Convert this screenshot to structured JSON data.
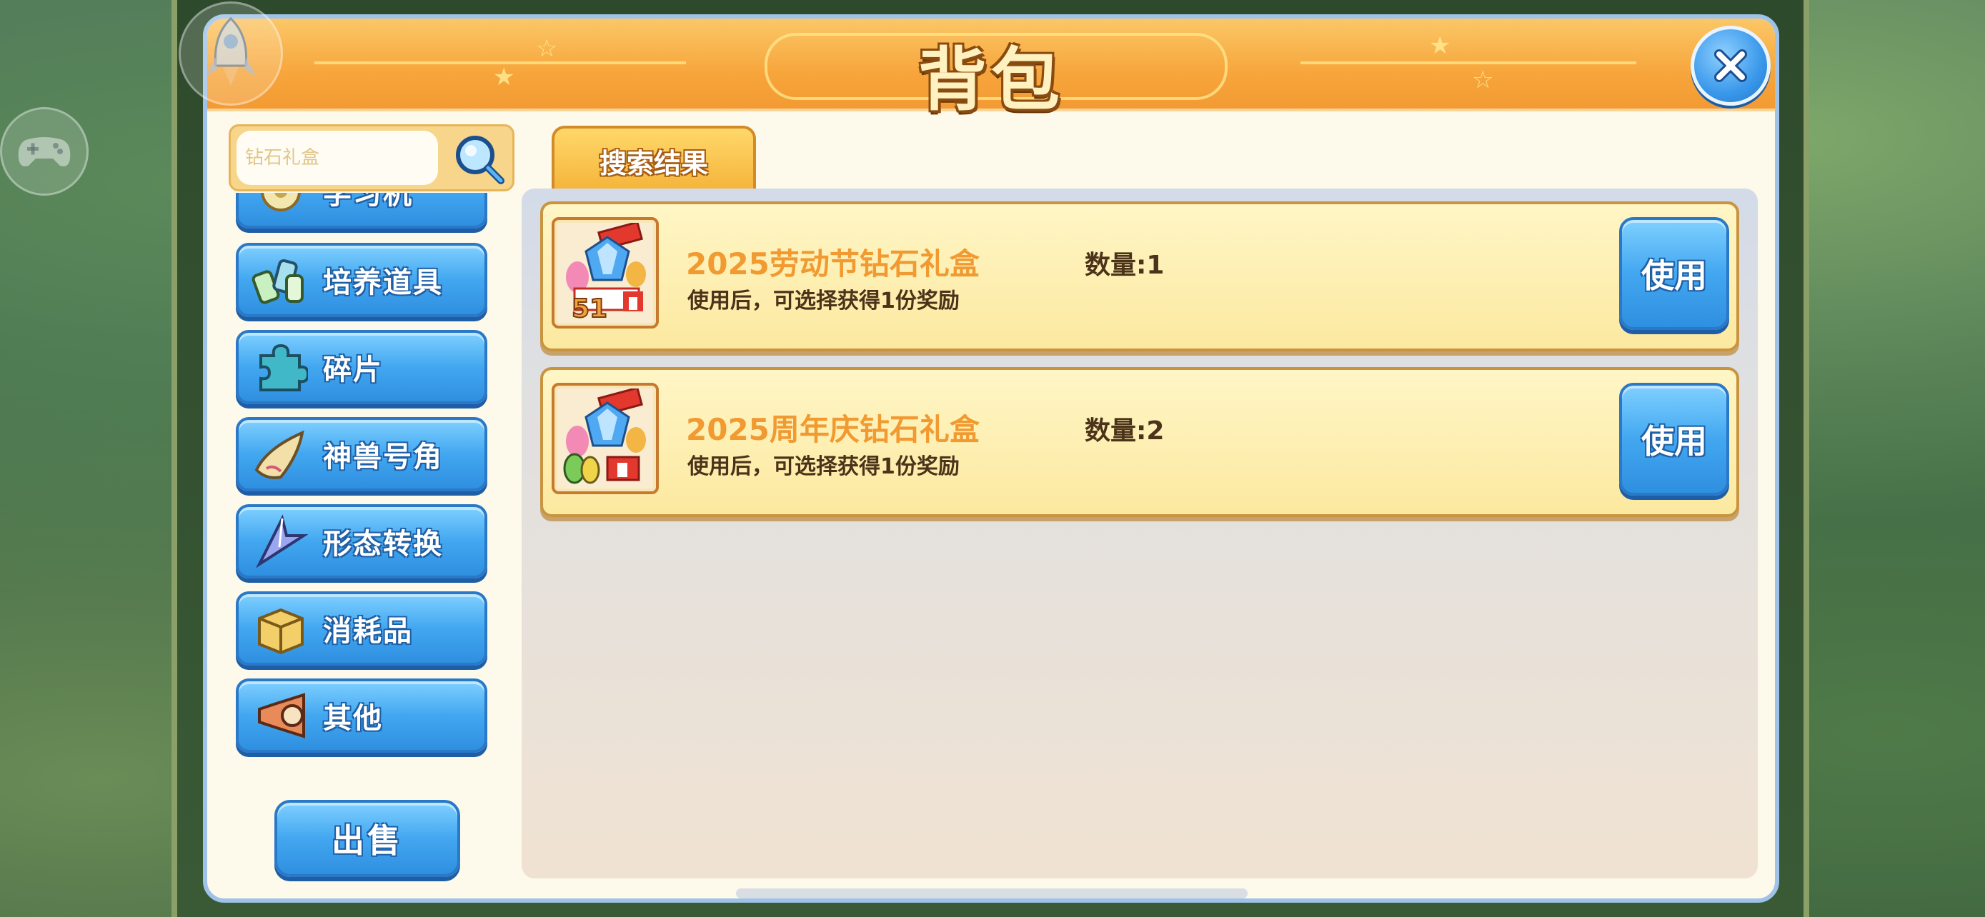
{
  "window": {
    "title": "背包"
  },
  "search": {
    "placeholder": "钻石礼盒",
    "value": ""
  },
  "sidebar": {
    "items": [
      {
        "label": "学习机",
        "icon": "study-machine-icon"
      },
      {
        "label": "培养道具",
        "icon": "potion-bottles-icon"
      },
      {
        "label": "碎片",
        "icon": "puzzle-piece-icon"
      },
      {
        "label": "神兽号角",
        "icon": "horn-icon"
      },
      {
        "label": "形态转换",
        "icon": "arrow-blade-icon"
      },
      {
        "label": "消耗品",
        "icon": "box-icon"
      },
      {
        "label": "其他",
        "icon": "loudspeaker-icon"
      }
    ],
    "sell_label": "出售"
  },
  "tabs": [
    {
      "label": "搜索结果",
      "active": true
    }
  ],
  "items": [
    {
      "name": "2025劳动节钻石礼盒",
      "description": "使用后，可选择获得1份奖励",
      "quantity_text": "数量:1",
      "quantity": 1,
      "badge": "51",
      "use_label": "使用",
      "icon": "labor-day-gift-box-icon"
    },
    {
      "name": "2025周年庆钻石礼盒",
      "description": "使用后，可选择获得1份奖励",
      "quantity_text": "数量:2",
      "quantity": 2,
      "use_label": "使用",
      "icon": "anniversary-gift-box-icon"
    }
  ],
  "colors": {
    "header_orange": "#f7a63c",
    "button_blue": "#42a7f0",
    "item_name_orange": "#f19a31",
    "card_yellow": "#fce9a0"
  }
}
